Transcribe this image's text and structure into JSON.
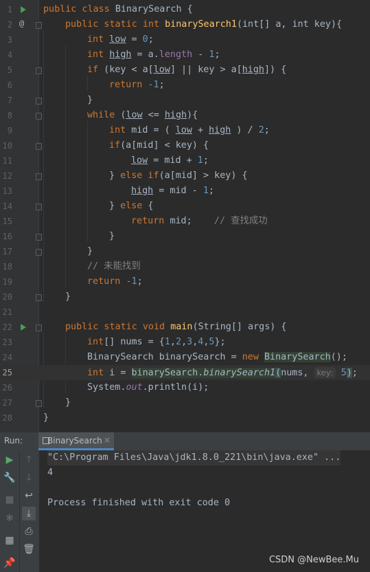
{
  "editor": {
    "line_numbers": [
      "1",
      "2",
      "3",
      "4",
      "5",
      "6",
      "7",
      "8",
      "9",
      "10",
      "11",
      "12",
      "13",
      "14",
      "15",
      "16",
      "17",
      "18",
      "19",
      "20",
      "21",
      "22",
      "23",
      "24",
      "25",
      "26",
      "27",
      "28"
    ],
    "gutter_icons": {
      "override": "@"
    },
    "tokens": {
      "l1": [
        "public class ",
        "BinarySearch",
        " {"
      ],
      "l2": [
        "public static int ",
        "binarySearch1",
        "(int[] a, int key){"
      ],
      "l3": [
        "int ",
        "low",
        " = ",
        "0",
        ";"
      ],
      "l4": [
        "int ",
        "high",
        " = a.",
        "length",
        " - ",
        "1",
        ";"
      ],
      "l5": [
        "if",
        " (key < a[",
        "low",
        "] || key > a[",
        "high",
        "]) {"
      ],
      "l6": [
        "return ",
        "-1",
        ";"
      ],
      "l7": [
        "}"
      ],
      "l8": [
        "while",
        " (",
        "low",
        " <= ",
        "high",
        "){"
      ],
      "l9": [
        "int ",
        "mid = ( ",
        "low",
        " + ",
        "high",
        " ) / ",
        "2",
        ";"
      ],
      "l10": [
        "if",
        "(a[mid] < key) {"
      ],
      "l11": [
        "low",
        " = mid + ",
        "1",
        ";"
      ],
      "l12": [
        "} ",
        "else if",
        "(a[mid] > key) {"
      ],
      "l13": [
        "high",
        " = mid - ",
        "1",
        ";"
      ],
      "l14": [
        "} ",
        "else",
        " {"
      ],
      "l15": [
        "return ",
        "mid;",
        "    // 查找成功"
      ],
      "l16": [
        "}"
      ],
      "l17": [
        "}"
      ],
      "l18": [
        "// 未能找到"
      ],
      "l19": [
        "return ",
        "-1",
        ";"
      ],
      "l20": [
        "}"
      ],
      "l22": [
        "public static void ",
        "main",
        "(String[] args) {"
      ],
      "l23": [
        "int",
        "[] nums = {",
        "1",
        ",",
        "2",
        ",",
        "3",
        ",",
        "4",
        ",",
        "5",
        "};"
      ],
      "l24": [
        "BinarySearch binarySearch = ",
        "new ",
        "BinarySearch",
        "();"
      ],
      "l25": [
        "int ",
        "i = ",
        "binarySearch.",
        "binarySearch1",
        "(",
        "nums, ",
        "key:",
        "5",
        ")",
        ";"
      ],
      "l26": [
        "System.",
        "out",
        ".println(i);"
      ],
      "l27": [
        "}"
      ],
      "l28": [
        "}"
      ]
    }
  },
  "run_panel": {
    "label": "Run:",
    "tab_label": "BinarySearch",
    "tab_close": "×",
    "output": [
      "\"C:\\Program Files\\Java\\jdk1.8.0_221\\bin\\java.exe\" ...",
      "4",
      "",
      "Process finished with exit code 0"
    ],
    "toolbar_icons": [
      "rerun-icon",
      "wrench-icon",
      "stop-icon",
      "debug-icon",
      "layout-icon",
      "pin-icon",
      "up-arrow-icon",
      "down-arrow-icon",
      "soft-wrap-icon",
      "scroll-to-end-icon",
      "print-icon",
      "trash-icon"
    ]
  },
  "watermark": "CSDN @NewBee.Mu",
  "colors": {
    "background": "#2b2b2b",
    "keyword": "#cc7832",
    "function": "#ffc66d",
    "number": "#6897bb",
    "field": "#9876aa",
    "comment": "#808080",
    "run_green": "#499c54"
  }
}
